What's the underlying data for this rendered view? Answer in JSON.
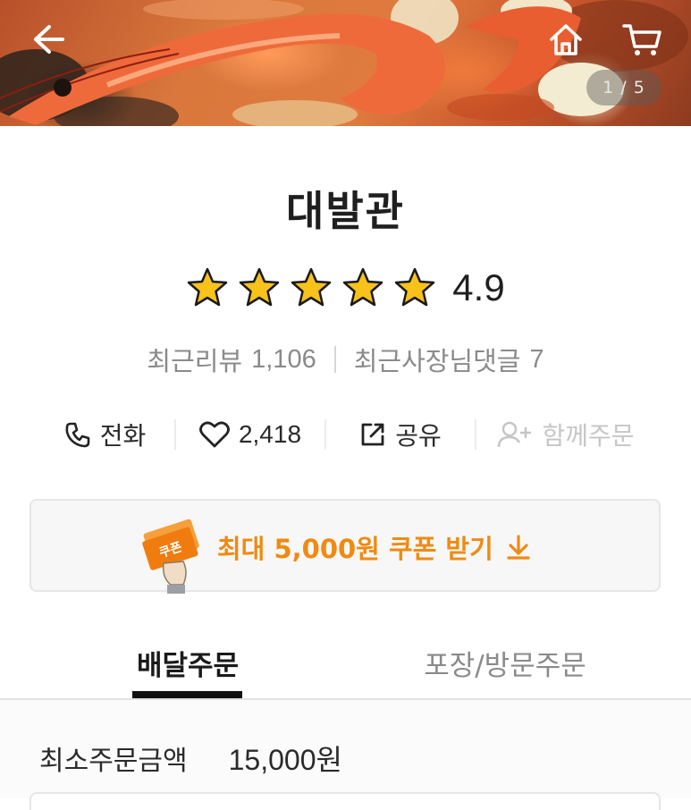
{
  "hero": {
    "pager_text": "1 / 5",
    "back_icon": "arrow-left-icon",
    "home_icon": "home-icon",
    "cart_icon": "cart-icon"
  },
  "store": {
    "name": "대발관",
    "rating": "4.9",
    "stars_filled": 5,
    "stars_total": 5,
    "review_label": "최근리뷰",
    "review_count": "1,106",
    "owner_reply_label": "최근사장님댓글",
    "owner_reply_count": "7"
  },
  "actions": {
    "call_label": "전화",
    "like_count": "2,418",
    "share_label": "공유",
    "group_order_label": "함께주문"
  },
  "coupon": {
    "text": "최대 5,000원 쿠폰 받기",
    "illustration_label": "쿠폰",
    "accent_color": "#f08a12"
  },
  "tabs": [
    {
      "label": "배달주문",
      "active": true
    },
    {
      "label": "포장/방문주문",
      "active": false
    }
  ],
  "order_info": {
    "min_order_label": "최소주문금액",
    "min_order_value": "15,000원"
  }
}
